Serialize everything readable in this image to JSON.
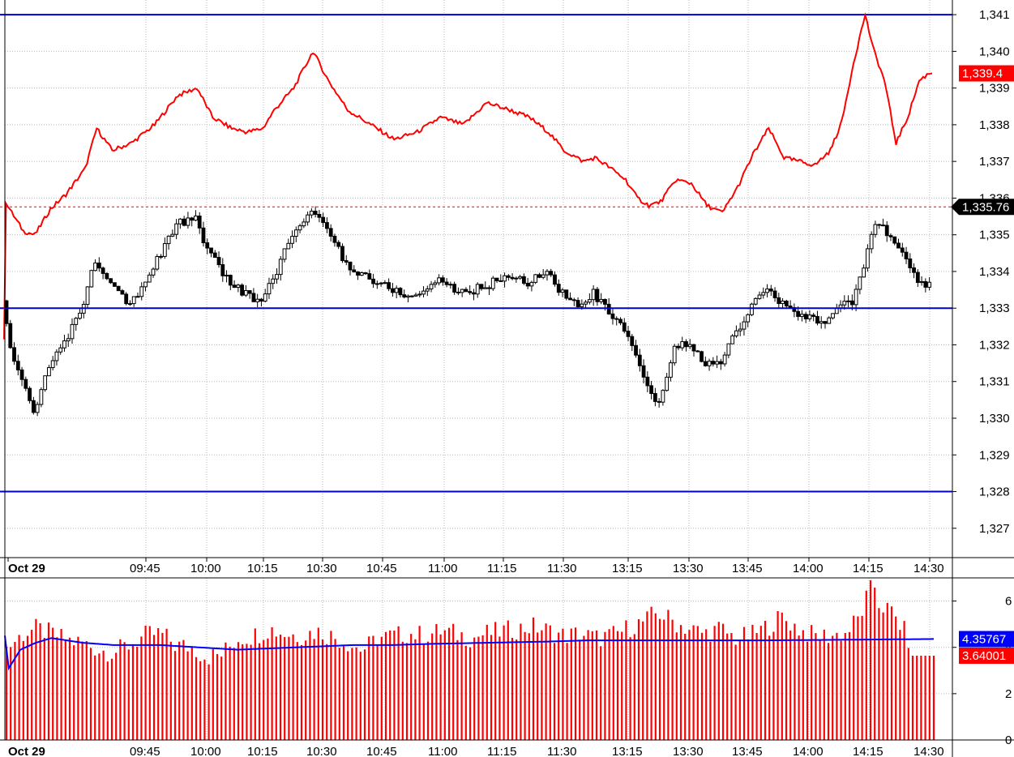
{
  "chart_data": [
    {
      "name": "price-panel",
      "type": "candlestick",
      "x_ticks": [
        "Oct 29",
        "09:45",
        "10:00",
        "10:15",
        "10:30",
        "10:45",
        "11:00",
        "11:15",
        "11:30",
        "13:15",
        "13:30",
        "13:45",
        "14:00",
        "14:15",
        "14:30"
      ],
      "y_ticks": [
        "1,327",
        "1,328",
        "1,329",
        "1,330",
        "1,331",
        "1,332",
        "1,333",
        "1,334",
        "1,335",
        "1,336",
        "1,337",
        "1,338",
        "1,339",
        "1,340",
        "1,341"
      ],
      "ylim": [
        1326.2,
        1341.4
      ],
      "horizontal_lines": [
        1341.0,
        1333.0,
        1328.0
      ],
      "dotted_level": 1335.76,
      "last_price_tag": "1,335.76",
      "overlay_tag": "1,339.4",
      "candle_anchors": [
        [
          0,
          1333.2
        ],
        [
          4,
          1331.8
        ],
        [
          10,
          1331.1
        ],
        [
          16,
          1330.2
        ],
        [
          24,
          1331.4
        ],
        [
          32,
          1332.0
        ],
        [
          42,
          1333.2
        ],
        [
          48,
          1334.3
        ],
        [
          56,
          1333.8
        ],
        [
          66,
          1333.1
        ],
        [
          78,
          1334.1
        ],
        [
          90,
          1335.3
        ],
        [
          100,
          1335.4
        ],
        [
          108,
          1334.4
        ],
        [
          118,
          1333.7
        ],
        [
          126,
          1333.4
        ],
        [
          134,
          1333.1
        ],
        [
          140,
          1333.8
        ],
        [
          150,
          1335.0
        ],
        [
          160,
          1335.6
        ],
        [
          168,
          1335.2
        ],
        [
          178,
          1334.2
        ],
        [
          190,
          1333.8
        ],
        [
          202,
          1333.5
        ],
        [
          214,
          1333.3
        ],
        [
          226,
          1333.8
        ],
        [
          238,
          1333.4
        ],
        [
          250,
          1333.6
        ],
        [
          262,
          1333.9
        ],
        [
          272,
          1333.7
        ],
        [
          282,
          1334.0
        ],
        [
          290,
          1333.4
        ],
        [
          300,
          1333.0
        ],
        [
          306,
          1333.4
        ],
        [
          312,
          1333.0
        ],
        [
          322,
          1332.4
        ],
        [
          328,
          1331.6
        ],
        [
          334,
          1330.8
        ],
        [
          340,
          1330.4
        ],
        [
          348,
          1331.9
        ],
        [
          356,
          1332.1
        ],
        [
          364,
          1331.4
        ],
        [
          372,
          1331.6
        ],
        [
          380,
          1332.3
        ],
        [
          388,
          1333.1
        ],
        [
          396,
          1333.5
        ],
        [
          404,
          1333.1
        ],
        [
          412,
          1332.8
        ],
        [
          420,
          1332.7
        ],
        [
          428,
          1332.7
        ],
        [
          434,
          1333.0
        ],
        [
          440,
          1333.2
        ],
        [
          446,
          1334.1
        ],
        [
          450,
          1335.1
        ],
        [
          456,
          1335.3
        ],
        [
          462,
          1334.7
        ],
        [
          468,
          1334.3
        ],
        [
          474,
          1333.7
        ],
        [
          479,
          1333.6
        ]
      ],
      "overlay_anchors": [
        [
          0,
          1332.1
        ],
        [
          1,
          1335.9
        ],
        [
          4,
          1335.6
        ],
        [
          10,
          1335.1
        ],
        [
          16,
          1335.0
        ],
        [
          24,
          1335.7
        ],
        [
          32,
          1336.1
        ],
        [
          42,
          1336.8
        ],
        [
          48,
          1337.9
        ],
        [
          56,
          1337.3
        ],
        [
          66,
          1337.5
        ],
        [
          78,
          1338.0
        ],
        [
          90,
          1338.8
        ],
        [
          100,
          1339.0
        ],
        [
          108,
          1338.2
        ],
        [
          118,
          1337.9
        ],
        [
          126,
          1337.8
        ],
        [
          134,
          1337.9
        ],
        [
          140,
          1338.4
        ],
        [
          150,
          1339.0
        ],
        [
          160,
          1340.0
        ],
        [
          168,
          1339.2
        ],
        [
          178,
          1338.4
        ],
        [
          190,
          1338.0
        ],
        [
          202,
          1337.6
        ],
        [
          214,
          1337.8
        ],
        [
          226,
          1338.2
        ],
        [
          238,
          1338.0
        ],
        [
          250,
          1338.6
        ],
        [
          262,
          1338.4
        ],
        [
          272,
          1338.2
        ],
        [
          282,
          1337.8
        ],
        [
          290,
          1337.3
        ],
        [
          300,
          1337.0
        ],
        [
          306,
          1337.1
        ],
        [
          312,
          1336.9
        ],
        [
          322,
          1336.5
        ],
        [
          328,
          1336.0
        ],
        [
          334,
          1335.8
        ],
        [
          340,
          1335.9
        ],
        [
          348,
          1336.5
        ],
        [
          356,
          1336.4
        ],
        [
          364,
          1335.8
        ],
        [
          372,
          1335.6
        ],
        [
          380,
          1336.3
        ],
        [
          388,
          1337.2
        ],
        [
          396,
          1337.9
        ],
        [
          404,
          1337.1
        ],
        [
          412,
          1337.0
        ],
        [
          420,
          1336.9
        ],
        [
          428,
          1337.3
        ],
        [
          434,
          1338.1
        ],
        [
          440,
          1339.7
        ],
        [
          446,
          1341.0
        ],
        [
          450,
          1340.1
        ],
        [
          456,
          1339.2
        ],
        [
          462,
          1337.5
        ],
        [
          468,
          1338.2
        ],
        [
          474,
          1339.2
        ],
        [
          479,
          1339.4
        ]
      ]
    },
    {
      "name": "volume-panel",
      "type": "bar",
      "x_ticks": [
        "Oct 29",
        "09:45",
        "10:00",
        "10:15",
        "10:30",
        "10:45",
        "11:00",
        "11:15",
        "11:30",
        "13:15",
        "13:30",
        "13:45",
        "14:00",
        "14:15",
        "14:30"
      ],
      "y_ticks": [
        "0",
        "2",
        "4",
        "6"
      ],
      "ylim": [
        0,
        7.0
      ],
      "ma_tag": "4.35767",
      "last_bar_tag": "3.64001",
      "volume_anchors": [
        [
          0,
          3.9
        ],
        [
          8,
          4.5
        ],
        [
          16,
          4.8
        ],
        [
          24,
          4.6
        ],
        [
          32,
          4.3
        ],
        [
          40,
          4.2
        ],
        [
          48,
          3.9
        ],
        [
          56,
          3.8
        ],
        [
          64,
          4.1
        ],
        [
          72,
          4.5
        ],
        [
          80,
          4.6
        ],
        [
          88,
          4.1
        ],
        [
          96,
          4.0
        ],
        [
          104,
          3.6
        ],
        [
          112,
          3.7
        ],
        [
          120,
          4.4
        ],
        [
          128,
          4.5
        ],
        [
          136,
          4.8
        ],
        [
          144,
          4.6
        ],
        [
          152,
          4.5
        ],
        [
          160,
          4.7
        ],
        [
          168,
          4.5
        ],
        [
          176,
          4.2
        ],
        [
          184,
          3.9
        ],
        [
          192,
          4.4
        ],
        [
          200,
          4.5
        ],
        [
          208,
          4.6
        ],
        [
          216,
          4.5
        ],
        [
          224,
          4.7
        ],
        [
          232,
          4.6
        ],
        [
          240,
          4.4
        ],
        [
          248,
          4.6
        ],
        [
          256,
          4.7
        ],
        [
          264,
          4.8
        ],
        [
          272,
          4.9
        ],
        [
          280,
          4.7
        ],
        [
          288,
          4.5
        ],
        [
          296,
          4.6
        ],
        [
          304,
          4.4
        ],
        [
          312,
          4.5
        ],
        [
          320,
          4.8
        ],
        [
          328,
          5.1
        ],
        [
          336,
          5.5
        ],
        [
          344,
          5.1
        ],
        [
          352,
          4.8
        ],
        [
          360,
          4.6
        ],
        [
          368,
          4.8
        ],
        [
          376,
          4.4
        ],
        [
          384,
          4.5
        ],
        [
          392,
          4.9
        ],
        [
          400,
          5.3
        ],
        [
          408,
          4.8
        ],
        [
          416,
          4.5
        ],
        [
          424,
          4.5
        ],
        [
          432,
          4.6
        ],
        [
          440,
          5.3
        ],
        [
          446,
          6.9
        ],
        [
          450,
          5.9
        ],
        [
          456,
          5.5
        ],
        [
          460,
          5.0
        ],
        [
          464,
          4.6
        ],
        [
          468,
          3.5
        ],
        [
          474,
          4.6
        ],
        [
          479,
          3.64
        ]
      ],
      "ma_anchors": [
        [
          0,
          4.5
        ],
        [
          2,
          3.1
        ],
        [
          8,
          3.9
        ],
        [
          16,
          4.2
        ],
        [
          24,
          4.4
        ],
        [
          32,
          4.3
        ],
        [
          40,
          4.2
        ],
        [
          56,
          4.1
        ],
        [
          80,
          4.1
        ],
        [
          100,
          4.0
        ],
        [
          120,
          3.9
        ],
        [
          150,
          4.0
        ],
        [
          180,
          4.1
        ],
        [
          200,
          4.1
        ],
        [
          220,
          4.15
        ],
        [
          250,
          4.2
        ],
        [
          280,
          4.25
        ],
        [
          300,
          4.3
        ],
        [
          330,
          4.3
        ],
        [
          360,
          4.3
        ],
        [
          390,
          4.3
        ],
        [
          420,
          4.32
        ],
        [
          450,
          4.34
        ],
        [
          479,
          4.36
        ]
      ]
    }
  ],
  "colors": {
    "up_candle": "#ffffff",
    "down_candle": "#000000",
    "overlay_line": "#ff0000",
    "level_line": "#0000cc",
    "volume_bar": "#ff0000",
    "volume_ma": "#0000ff",
    "last_price_tag_bg": "#000000",
    "overlay_tag_bg": "#ff0000",
    "ma_tag_bg": "#0000ff",
    "last_bar_tag_bg": "#ff0000"
  }
}
